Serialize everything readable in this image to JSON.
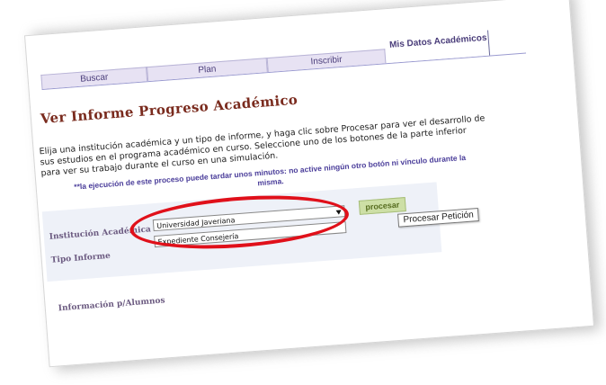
{
  "tabs": [
    {
      "label": "Buscar"
    },
    {
      "label": "Plan"
    },
    {
      "label": "Inscribir"
    },
    {
      "label": "Mis Datos Académicos"
    }
  ],
  "page_title": "Ver Informe Progreso Académico",
  "description": "Elija una institución académica y un tipo de informe, y haga clic sobre Procesar para ver el desarrollo de sus estudios en el programa académico en curso. Seleccione uno de los botones de la parte inferior para ver su trabajo durante el curso en una simulación.",
  "warning": "**la ejecución de este proceso puede tardar unos minutos: no active ningún otro botón ni vínculo durante la misma.",
  "form": {
    "institucion_label": "Institución Académica",
    "institucion_value": "Universidad Javeriana",
    "tipo_label": "Tipo Informe",
    "tipo_value": "Expediente Consejería",
    "procesar_label": "procesar",
    "tooltip": "Procesar Petición"
  },
  "info_label": "Información p/Alumnos",
  "colors": {
    "title": "#7a2b1e",
    "tab_bg": "#e7e2f3",
    "link": "#4a3d9a",
    "button_bg": "#cddfa6",
    "highlight": "#e0101a"
  },
  "icons": {
    "dropdown": "chevron-down-icon"
  }
}
